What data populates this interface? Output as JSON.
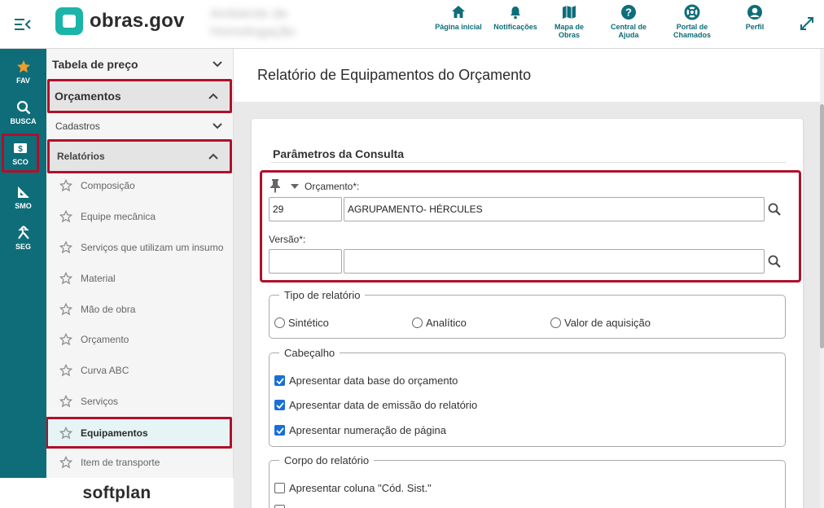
{
  "header": {
    "logo_text": "obras.gov",
    "environment_name": "Ambiente de Homologação",
    "actions": [
      {
        "label": "Página inicial",
        "icon": "home-icon"
      },
      {
        "label": "Notificações",
        "icon": "bell-icon"
      },
      {
        "label": "Mapa de Obras",
        "icon": "map-icon"
      },
      {
        "label": "Central de Ajuda",
        "icon": "help-icon"
      },
      {
        "label": "Portal de Chamados",
        "icon": "lifebuoy-icon"
      },
      {
        "label": "Perfil",
        "icon": "user-icon"
      }
    ]
  },
  "rail": {
    "items": [
      {
        "label": "FAV",
        "icon": "star-icon"
      },
      {
        "label": "BUSCA",
        "icon": "search-icon"
      },
      {
        "label": "SCO",
        "icon": "money-icon"
      },
      {
        "label": "SMO",
        "icon": "ruler-icon"
      },
      {
        "label": "SEG",
        "icon": "merge-icon"
      }
    ]
  },
  "brand_footer": "softplan",
  "sidebar": {
    "tabela_preco": "Tabela de preço",
    "orcamentos": "Orçamentos",
    "cadastros": "Cadastros",
    "relatorios": "Relatórios",
    "items": [
      "Composição",
      "Equipe mecânica",
      "Serviços que utilizam um insumo",
      "Material",
      "Mão de obra",
      "Orçamento",
      "Curva ABC",
      "Serviços",
      "Equipamentos",
      "Item de transporte"
    ],
    "selected_item": "Equipamentos"
  },
  "main": {
    "title": "Relatório de Equipamentos do Orçamento",
    "section_title": "Parâmetros da Consulta",
    "orcamento": {
      "label": "Orçamento*:",
      "code": "29",
      "name": "AGRUPAMENTO- HÉRCULES"
    },
    "versao": {
      "label": "Versão*:",
      "code": "",
      "name": ""
    },
    "tipo_relatorio": {
      "legend": "Tipo de relatório",
      "options": [
        "Sintético",
        "Analítico",
        "Valor de aquisição"
      ]
    },
    "cabecalho": {
      "legend": "Cabeçalho",
      "options": [
        {
          "label": "Apresentar data base do orçamento",
          "checked": true
        },
        {
          "label": "Apresentar data de emissão do relatório",
          "checked": true
        },
        {
          "label": "Apresentar numeração de página",
          "checked": true
        }
      ]
    },
    "corpo": {
      "legend": "Corpo do relatório",
      "options": [
        {
          "label": "Apresentar coluna \"Cód. Sist.\"",
          "checked": false
        }
      ]
    }
  },
  "colors": {
    "brand_teal": "#0e6d79",
    "logo_green": "#1ab5a8",
    "highlight_red": "#b0102a",
    "checkbox_blue": "#1a6fd6"
  }
}
